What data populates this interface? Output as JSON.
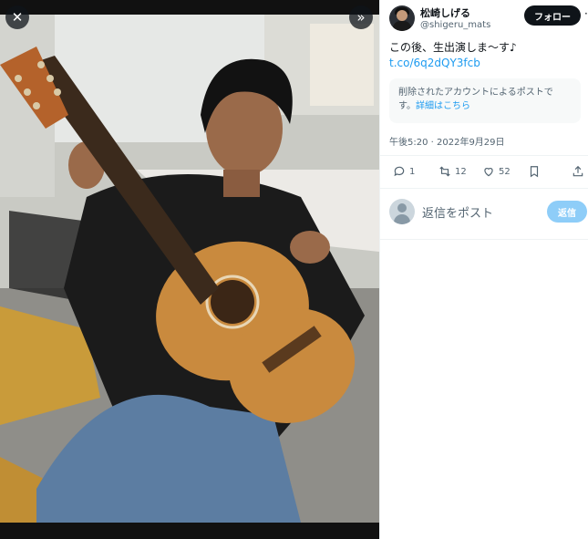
{
  "media": {
    "close_icon": "close-icon",
    "expand_icon": "chevron-double-right-icon",
    "photo_alt": "man-playing-acoustic-guitar"
  },
  "author": {
    "display_name": "松崎しげる",
    "handle": "@shigeru_mats",
    "follow_label": "フォロー",
    "more_icon": "more-icon"
  },
  "tweet": {
    "text": "この後、生出演しま〜す♪",
    "link": "t.co/6q2dQY3fcb",
    "quote_line1": "削除されたアカウントによるポストで",
    "quote_line2_prefix": "す。",
    "quote_line2_link": "詳細はこちら",
    "timestamp": "午後5:20 · 2022年9月29日"
  },
  "actions": {
    "replies": "1",
    "reposts": "12",
    "likes": "52"
  },
  "reply_box": {
    "placeholder": "返信をポスト",
    "button_label": "返信"
  },
  "colors": {
    "accent": "#1d9bf0",
    "follow_bg": "#0f1419",
    "reply_btn_bg": "#8ecdf8"
  }
}
